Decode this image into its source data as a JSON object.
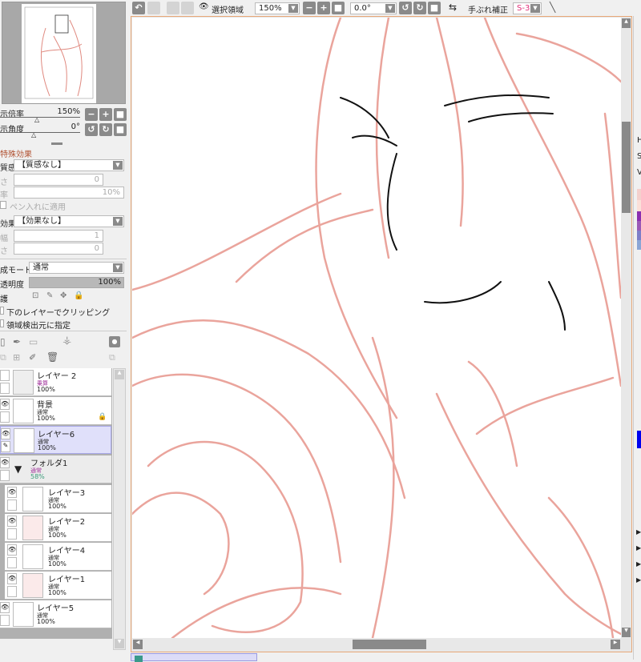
{
  "navigator": {
    "zoom_label": "示倍率",
    "zoom_value": "150%",
    "angle_label": "示角度",
    "angle_value": "0°"
  },
  "effects": {
    "title": "特殊効果",
    "texture_label": "質感",
    "texture_value": "【質感なし】",
    "scale_label": "さ",
    "scale_value": "0",
    "strength_label": "率",
    "strength_value": "10%",
    "apply_pen": "ペン入れに適用",
    "effect_label": "効果",
    "effect_value": "【効果なし】",
    "width_label": "幅",
    "width_value": "1",
    "intensity_label": "さ",
    "intensity_value": "0"
  },
  "layer_props": {
    "blend_label": "成モード",
    "blend_value": "通常",
    "opacity_label": "透明度",
    "opacity_value": "100%",
    "opacity_fraction": 1.0,
    "protect_label": "護",
    "clip_label": "下のレイヤーでクリッピング",
    "select_src_label": "領域検出元に指定"
  },
  "layers": [
    {
      "name": "レイヤー 2",
      "mode": "乗算",
      "opacity": "100%",
      "mode_color": "#a0309a"
    },
    {
      "name": "背景",
      "mode": "通常",
      "opacity": "100%",
      "locked": true
    },
    {
      "name": "レイヤー6",
      "mode": "通常",
      "opacity": "100%",
      "selected": true
    },
    {
      "name": "フォルダ1",
      "mode": "通常",
      "opacity": "58%",
      "folder": true
    },
    {
      "name": "レイヤー3",
      "mode": "通常",
      "opacity": "100%"
    },
    {
      "name": "レイヤー2",
      "mode": "通常",
      "opacity": "100%"
    },
    {
      "name": "レイヤー4",
      "mode": "通常",
      "opacity": "100%"
    },
    {
      "name": "レイヤー1",
      "mode": "通常",
      "opacity": "100%"
    },
    {
      "name": "レイヤー5",
      "mode": "通常",
      "opacity": "100%"
    }
  ],
  "toolbar": {
    "selection_label": "選択領域",
    "zoom": "150%",
    "angle": "0.0°",
    "stabilizer_label": "手ぶれ補正",
    "stabilizer_value": "S-3"
  },
  "right_panel": {
    "h": "H",
    "s": "S",
    "v": "V",
    "swatches": [
      "#f4d0cc",
      "#fbe0d8",
      "#8b2fb0",
      "#9b59b6",
      "#7e7ec8",
      "#8aa6d6"
    ],
    "primary_color": "#0000ee"
  }
}
